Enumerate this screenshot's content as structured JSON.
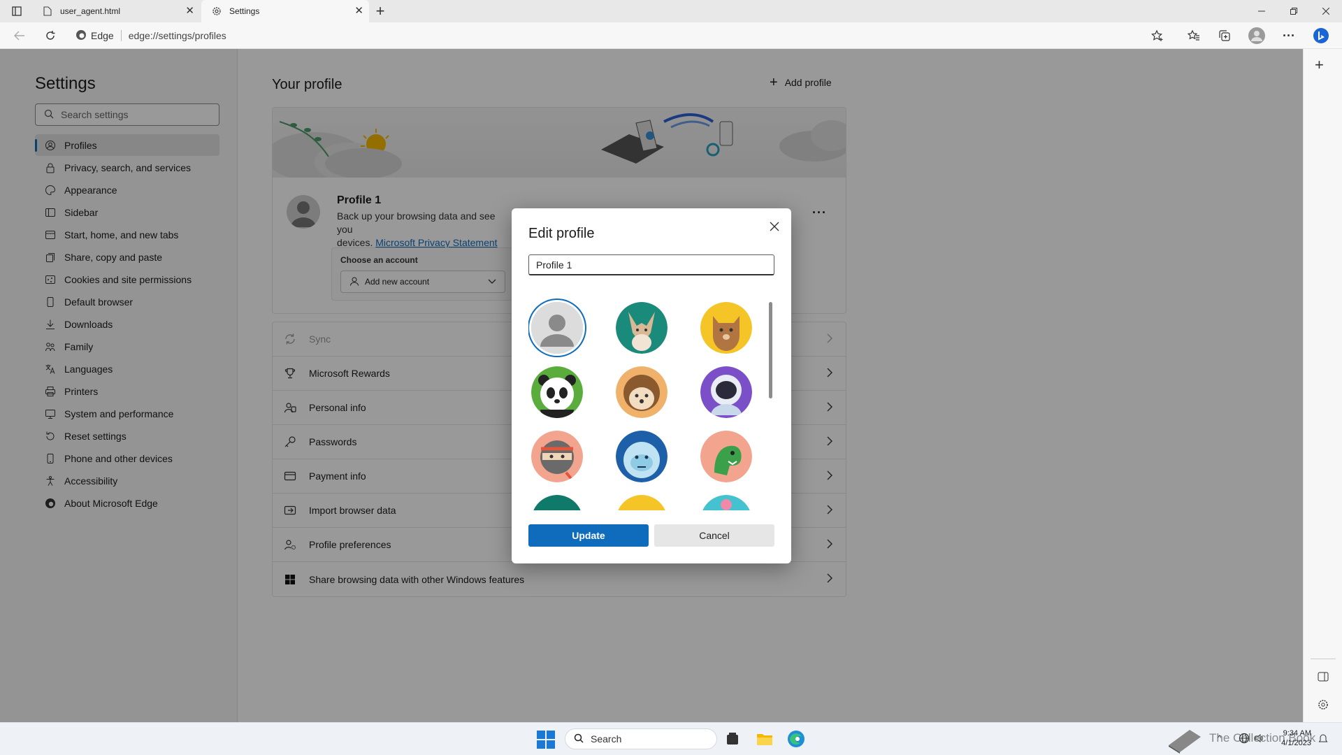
{
  "browser": {
    "tabs": [
      {
        "title": "user_agent.html",
        "icon": "file-icon"
      },
      {
        "title": "Settings",
        "icon": "gear-icon",
        "active": true
      }
    ],
    "address": {
      "brand": "Edge",
      "url": "edge://settings/profiles"
    }
  },
  "settings": {
    "title": "Settings",
    "search_placeholder": "Search settings",
    "nav": [
      {
        "label": "Profiles",
        "icon": "profile-icon",
        "selected": true
      },
      {
        "label": "Privacy, search, and services",
        "icon": "lock-icon"
      },
      {
        "label": "Appearance",
        "icon": "palette-icon"
      },
      {
        "label": "Sidebar",
        "icon": "sidebar-icon"
      },
      {
        "label": "Start, home, and new tabs",
        "icon": "home-icon"
      },
      {
        "label": "Share, copy and paste",
        "icon": "share-icon"
      },
      {
        "label": "Cookies and site permissions",
        "icon": "cookie-icon"
      },
      {
        "label": "Default browser",
        "icon": "browser-icon"
      },
      {
        "label": "Downloads",
        "icon": "download-icon"
      },
      {
        "label": "Family",
        "icon": "family-icon"
      },
      {
        "label": "Languages",
        "icon": "language-icon"
      },
      {
        "label": "Printers",
        "icon": "printer-icon"
      },
      {
        "label": "System and performance",
        "icon": "system-icon"
      },
      {
        "label": "Reset settings",
        "icon": "reset-icon"
      },
      {
        "label": "Phone and other devices",
        "icon": "phone-icon"
      },
      {
        "label": "Accessibility",
        "icon": "accessibility-icon"
      },
      {
        "label": "About Microsoft Edge",
        "icon": "edge-icon"
      }
    ]
  },
  "main": {
    "heading": "Your profile",
    "add_profile": "Add profile",
    "profile": {
      "name": "Profile 1",
      "desc": "Back up your browsing data and see you",
      "desc2": "devices.",
      "privacy_link": "Microsoft Privacy Statement",
      "choose_account": "Choose an account",
      "add_account": "Add new account"
    },
    "rows": [
      {
        "label": "Sync",
        "icon": "sync-icon",
        "disabled": true
      },
      {
        "label": "Microsoft Rewards",
        "icon": "trophy-icon"
      },
      {
        "label": "Personal info",
        "icon": "person-card-icon"
      },
      {
        "label": "Passwords",
        "icon": "key-icon"
      },
      {
        "label": "Payment info",
        "icon": "card-icon"
      },
      {
        "label": "Import browser data",
        "icon": "import-icon"
      },
      {
        "label": "Profile preferences",
        "icon": "profile-settings-icon"
      },
      {
        "label": "Share browsing data with other Windows features",
        "icon": "windows-icon"
      }
    ]
  },
  "dialog": {
    "title": "Edit profile",
    "name_value": "Profile 1",
    "update": "Update",
    "cancel": "Cancel",
    "avatars": [
      "default-person",
      "fennec-fox",
      "cat",
      "panda",
      "hedgehog",
      "astronaut",
      "ninja",
      "yeti",
      "dinosaur",
      "partial-1",
      "partial-2",
      "partial-3"
    ],
    "selected_avatar": "default-person"
  },
  "taskbar": {
    "search": "Search",
    "time": "9:34 AM",
    "date": "4/1/2023",
    "watermark": "The Collection Book"
  },
  "colors": {
    "accent": "#0f6cbd",
    "overlay": "rgba(0,0,0,0.40)"
  }
}
